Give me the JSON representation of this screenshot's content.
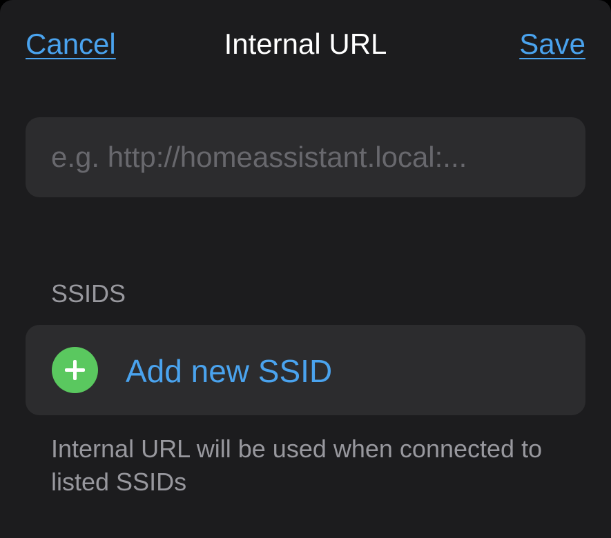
{
  "header": {
    "cancel_label": "Cancel",
    "title": "Internal URL",
    "save_label": "Save"
  },
  "url_field": {
    "value": "",
    "placeholder": "e.g. http://homeassistant.local:..."
  },
  "ssids_section": {
    "header": "SSIDS",
    "add_label": "Add new SSID",
    "add_icon": "plus-circle-icon",
    "footer": "Internal URL will be used when connected to listed SSIDs"
  },
  "colors": {
    "accent": "#4aa3ee",
    "add_icon": "#5ac85f",
    "background": "#1c1c1e",
    "cell": "#2c2c2e"
  }
}
